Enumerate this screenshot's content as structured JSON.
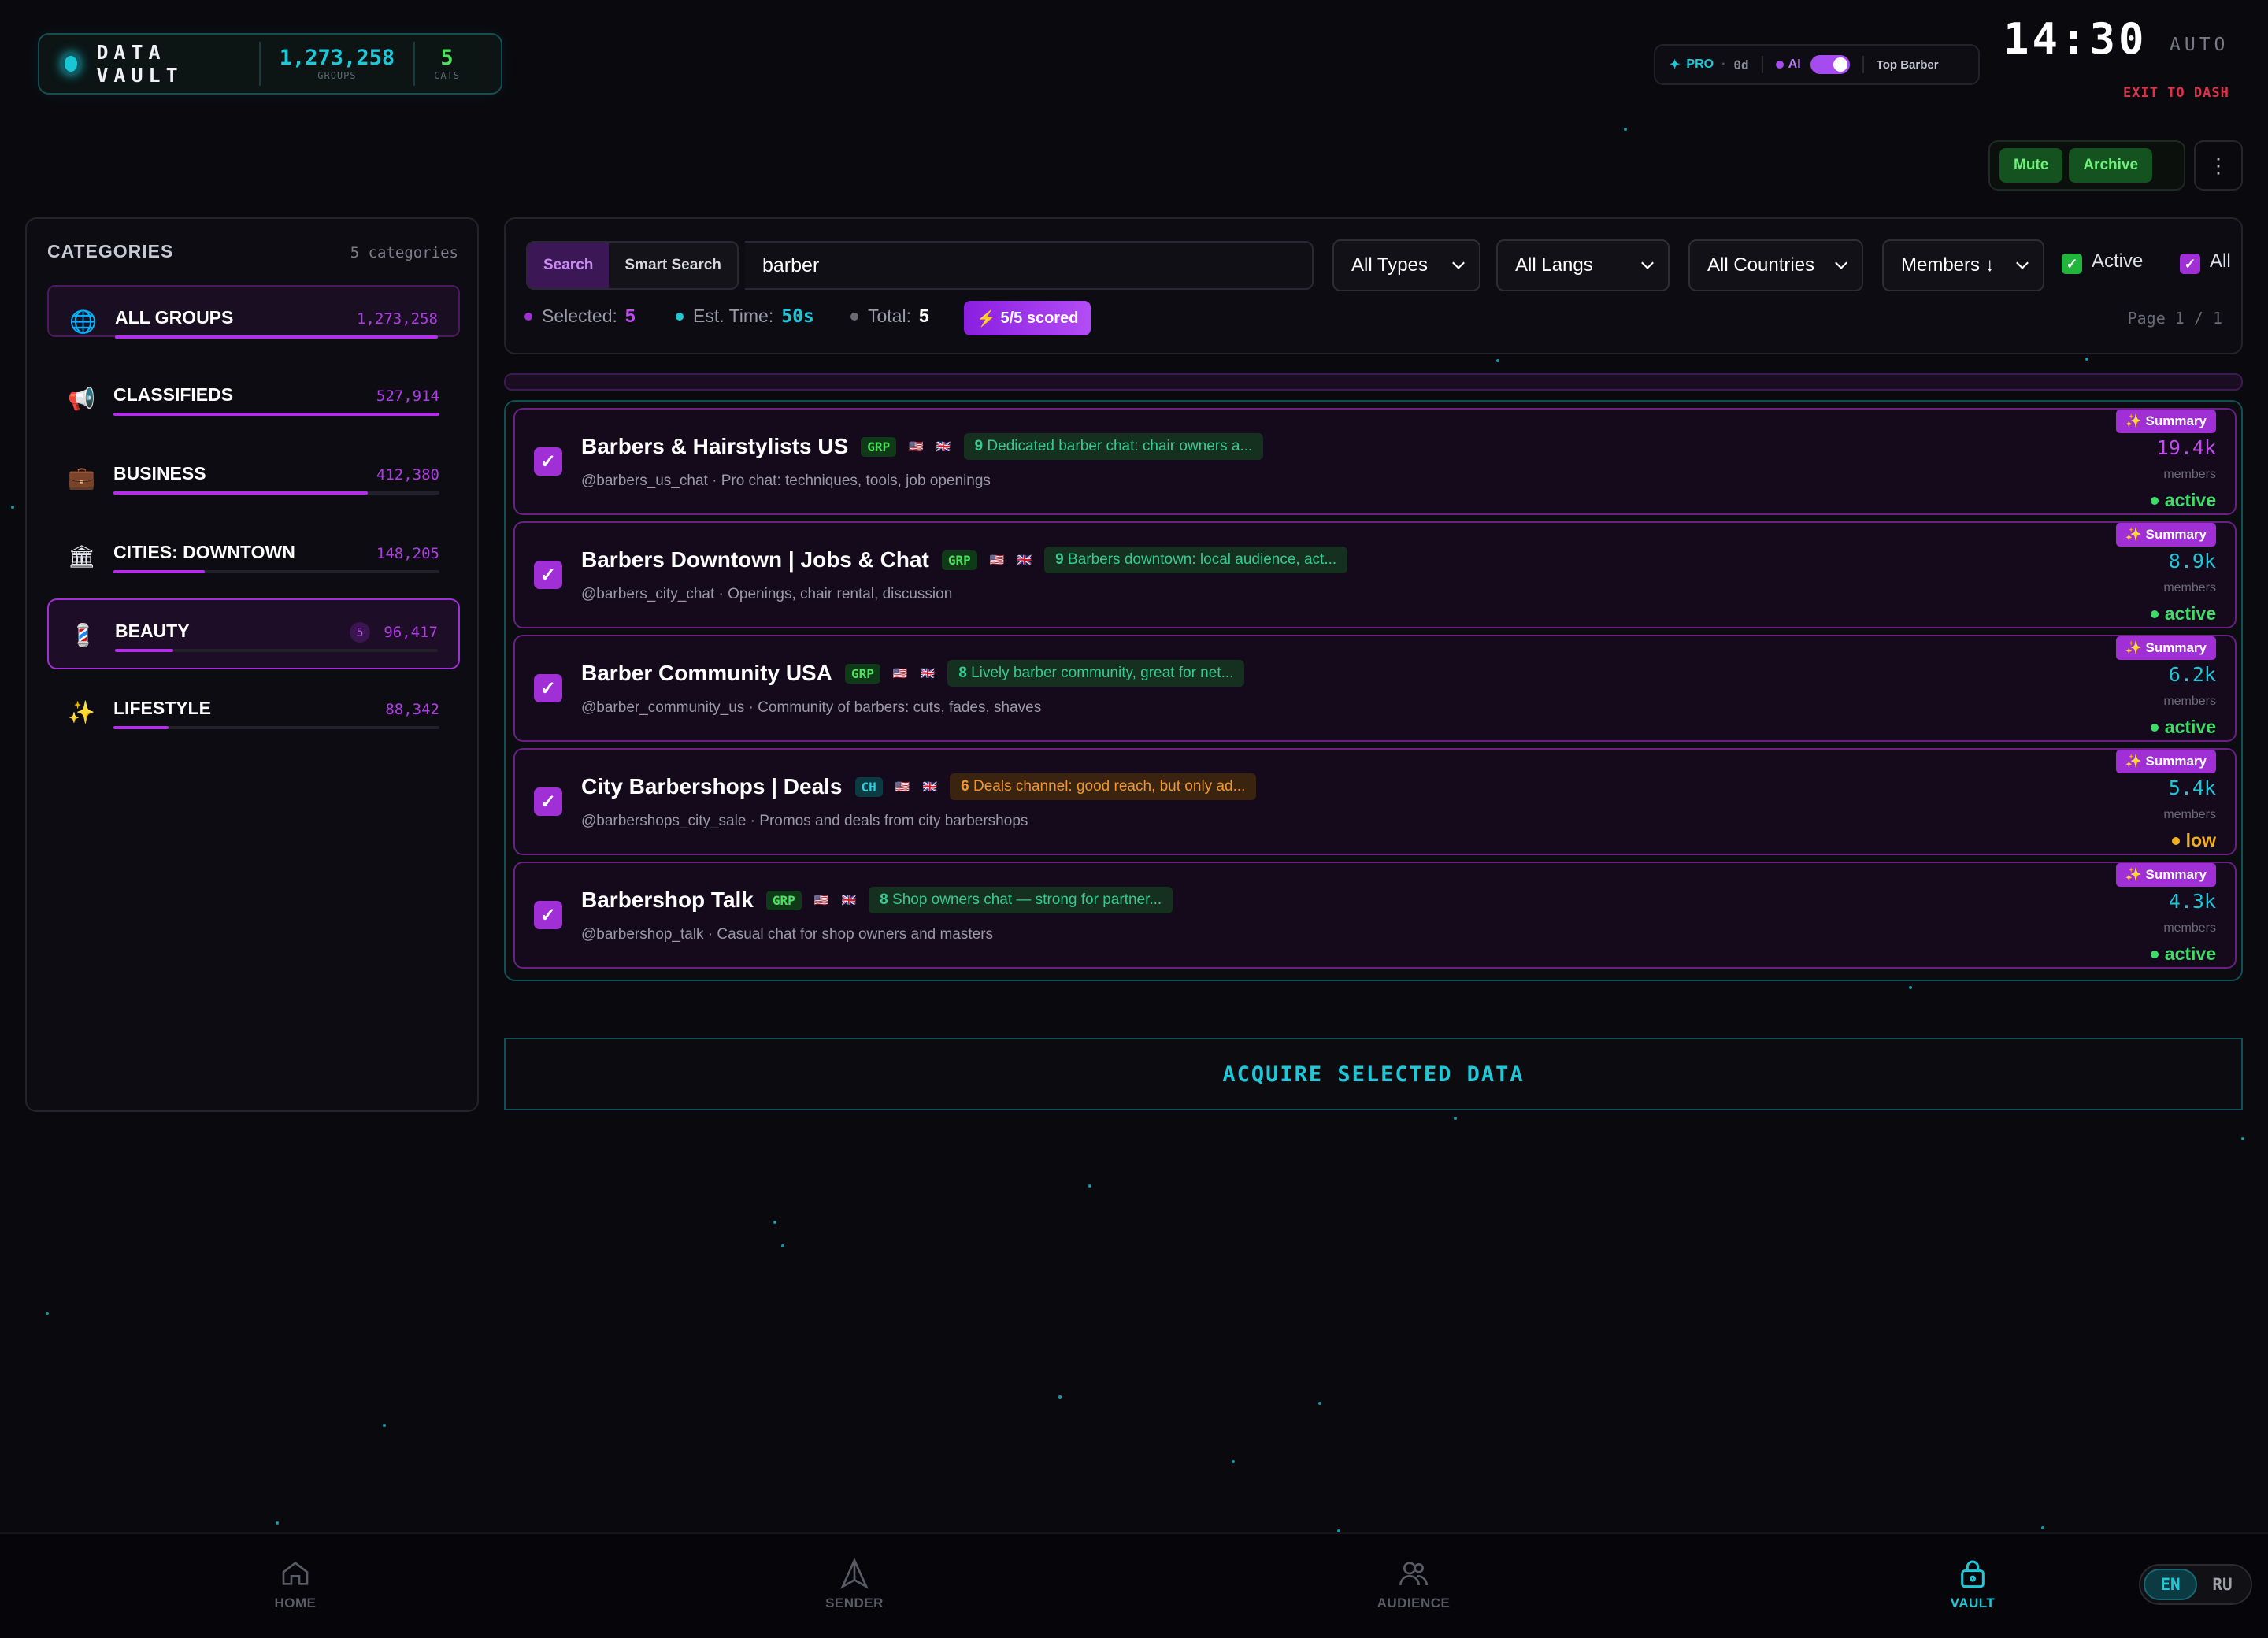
{
  "header": {
    "brand_title": "DATA VAULT",
    "groups_value": "1,273,258",
    "groups_label": "GROUPS",
    "cats_value": "5",
    "cats_label": "CATS",
    "pro_label": "PRO",
    "days_label": "0d",
    "ai_label": "AI",
    "profile_name": "Top Barber",
    "clock": "14:30",
    "mode": "AUTO",
    "exit_label": "EXIT TO DASH"
  },
  "actions": {
    "mute_label": "Mute",
    "archive_label": "Archive",
    "more_icon": "more-vertical-icon"
  },
  "sidebar": {
    "title": "CATEGORIES",
    "count": "5 categories",
    "items": [
      {
        "name": "ALL GROUPS",
        "count": "1,273,258",
        "icon": "globe-icon",
        "fill": 1.0
      },
      {
        "name": "CLASSIFIEDS",
        "count": "527,914",
        "icon": "megaphone-icon",
        "fill": 1.0
      },
      {
        "name": "BUSINESS",
        "count": "412,380",
        "icon": "briefcase-icon",
        "fill": 0.78
      },
      {
        "name": "CITIES: DOWNTOWN",
        "count": "148,205",
        "icon": "bank-icon",
        "fill": 0.28
      },
      {
        "name": "BEAUTY",
        "count": "96,417",
        "badge": "5",
        "icon": "barber-pole-icon",
        "fill": 0.18
      },
      {
        "name": "LIFESTYLE",
        "count": "88,342",
        "icon": "sparkles-icon",
        "fill": 0.17
      }
    ]
  },
  "search": {
    "tab_search": "Search",
    "tab_smart": "Smart Search",
    "query": "barber",
    "type_filter": "All Types",
    "lang_filter": "All Langs",
    "country_filter": "All Countries",
    "sort": "Members ↓",
    "active_label": "Active",
    "all_label": "All",
    "selected_label": "Selected:",
    "selected_value": "5",
    "est_label": "Est. Time:",
    "est_value": "50s",
    "total_label": "Total:",
    "total_value": "5",
    "scored": "5/5 scored",
    "page": "Page 1 / 1"
  },
  "results": [
    {
      "title": "Barbers & Hairstylists US",
      "tag": "GRP",
      "score": "9",
      "note": "Dedicated barber chat: chair owners a...",
      "note_color": "g",
      "handle": "@barbers_us_chat · Pro chat: techniques, tools, job openings",
      "members": "19.4k",
      "mem_color": "#c04cf0",
      "status": "active",
      "status_color": "#3fdc6a"
    },
    {
      "title": "Barbers Downtown | Jobs & Chat",
      "tag": "GRP",
      "score": "9",
      "note": "Barbers downtown: local audience, act...",
      "note_color": "g",
      "handle": "@barbers_city_chat · Openings, chair rental, discussion",
      "members": "8.9k",
      "mem_color": "#1ec8d8",
      "status": "active",
      "status_color": "#3fdc6a"
    },
    {
      "title": "Barber Community USA",
      "tag": "GRP",
      "score": "8",
      "note": "Lively barber community, great for net...",
      "note_color": "g",
      "handle": "@barber_community_us · Community of barbers: cuts, fades, shaves",
      "members": "6.2k",
      "mem_color": "#1ec8d8",
      "status": "active",
      "status_color": "#3fdc6a"
    },
    {
      "title": "City Barbershops | Deals",
      "tag": "CH",
      "score": "6",
      "note": "Deals channel: good reach, but only ad...",
      "note_color": "o",
      "handle": "@barbershops_city_sale · Promos and deals from city barbershops",
      "members": "5.4k",
      "mem_color": "#1ec8d8",
      "status": "low",
      "status_color": "#f0b020"
    },
    {
      "title": "Barbershop Talk",
      "tag": "GRP",
      "score": "8",
      "note": "Shop owners chat — strong for partner...",
      "note_color": "g",
      "handle": "@barbershop_talk · Casual chat for shop owners and masters",
      "members": "4.3k",
      "mem_color": "#1ec8d8",
      "status": "active",
      "status_color": "#3fdc6a"
    }
  ],
  "result_labels": {
    "summary": "Summary",
    "members": "members"
  },
  "acquire_label": "ACQUIRE SELECTED DATA",
  "nav": {
    "home": "HOME",
    "sender": "SENDER",
    "audience": "AUDIENCE",
    "vault": "VAULT"
  },
  "lang": {
    "en": "EN",
    "ru": "RU"
  },
  "colors": {
    "accent_cyan": "#1ec8d8",
    "accent_purple": "#a12fd6",
    "green": "#3fdc6a",
    "orange": "#f0962b",
    "red": "#e0314a"
  }
}
